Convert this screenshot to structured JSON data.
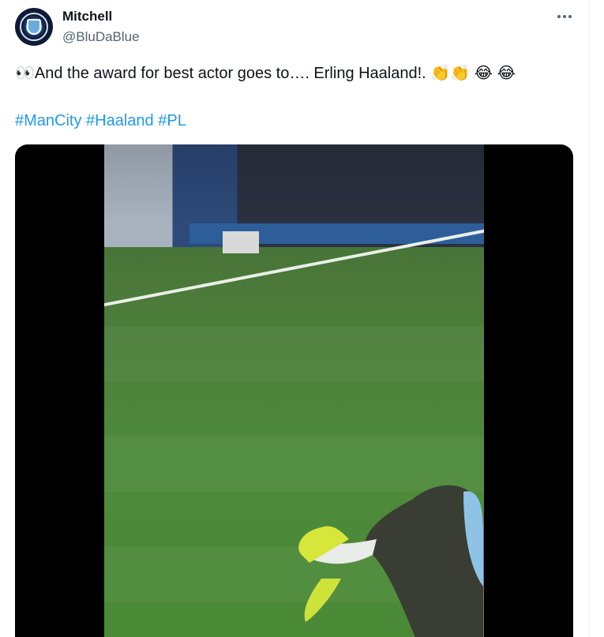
{
  "tweet": {
    "author_name": "Mitchell",
    "author_handle": "@BluDaBlue",
    "text": "👀And the award for best actor goes to….  Erling Haaland!. 👏👏 😂 😂",
    "hashtags": [
      "#ManCity",
      "#Haaland",
      "#PL"
    ]
  },
  "icons": {
    "more": "more-horizontal-icon",
    "avatar": "man-city-crest-avatar"
  },
  "colors": {
    "link": "#1d9bf0",
    "secondary_text": "#536471",
    "primary_text": "#0f1419"
  }
}
